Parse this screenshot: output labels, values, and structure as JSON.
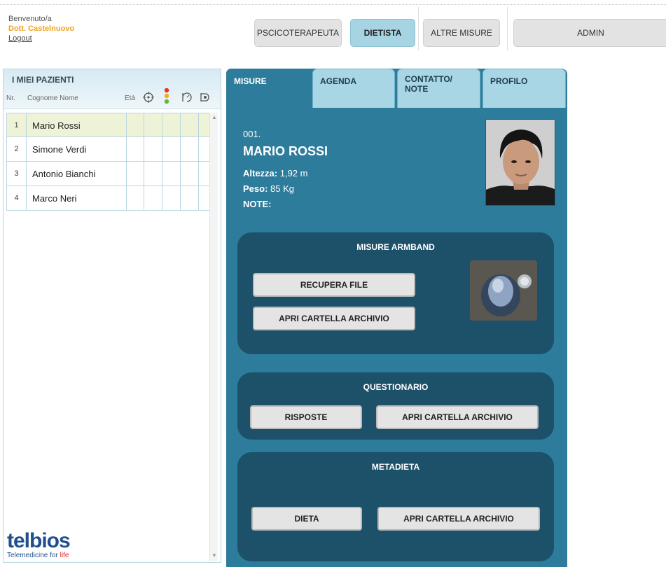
{
  "header": {
    "greeting": "Benvenuto/a",
    "doctor": "Dott. Castelnuovo",
    "logout": "Logout"
  },
  "nav": {
    "items": [
      {
        "label": "PSCICOTERAPEUTA",
        "active": false
      },
      {
        "label": "DIETISTA",
        "active": true
      },
      {
        "label": "ALTRE MISURE",
        "active": false
      },
      {
        "label": "ADMIN",
        "active": false
      }
    ]
  },
  "patients": {
    "title": "I MIEI PAZIENTI",
    "col_nr": "Nr.",
    "col_name": "Cognome Nome",
    "col_age": "Età",
    "header_icons": [
      "target-icon",
      "traffic-light-icon",
      "scale-icon",
      "stopwatch-icon"
    ],
    "rows": [
      {
        "nr": "1",
        "name": "Mario Rossi",
        "selected": true
      },
      {
        "nr": "2",
        "name": "Simone Verdi",
        "selected": false
      },
      {
        "nr": "3",
        "name": "Antonio Bianchi",
        "selected": false
      },
      {
        "nr": "4",
        "name": "Marco Neri",
        "selected": false
      }
    ]
  },
  "logo": {
    "word": "telbios",
    "tag_prefix": "Telemedicine for ",
    "tag_accent": "life"
  },
  "tabs": [
    {
      "label": "MISURE",
      "active": true
    },
    {
      "label": "AGENDA",
      "active": false
    },
    {
      "label": "CONTATTO/\nNOTE",
      "active": false
    },
    {
      "label": "PROFILO",
      "active": false
    }
  ],
  "profile": {
    "number": "001.",
    "name": "MARIO ROSSI",
    "height_label": "Altezza:",
    "height_value": " 1,92 m",
    "weight_label": "Peso:",
    "weight_value": " 85 Kg",
    "notes_label": "NOTE:"
  },
  "armband": {
    "title": "MISURE ARMBAND",
    "recupera": "RECUPERA FILE",
    "apri": "APRI CARTELLA ARCHIVIO"
  },
  "questionario": {
    "title": "QUESTIONARIO",
    "risposte": "RISPOSTE",
    "apri": "APRI CARTELLA ARCHIVIO"
  },
  "metadieta": {
    "title": "METADIETA",
    "dieta": "DIETA",
    "apri": "APRI CARTELLA ARCHIVIO"
  },
  "colors": {
    "accent_orange": "#f0a21e",
    "panel_blue": "#2e7c9b",
    "section_dark": "#1d5069",
    "tab_light": "#a9d6e4",
    "nav_active": "#a7d4e2"
  }
}
